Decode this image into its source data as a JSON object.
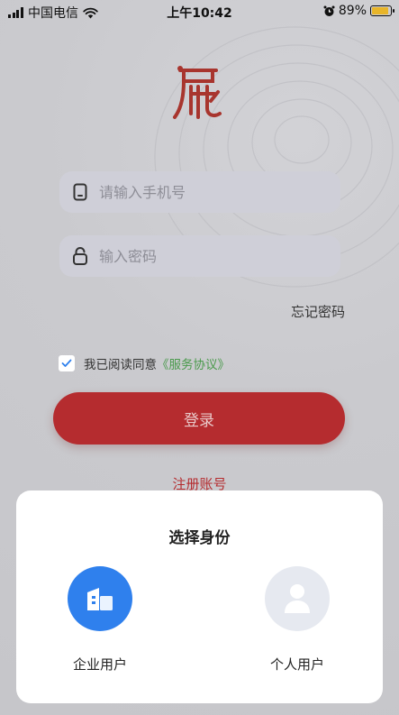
{
  "status_bar": {
    "carrier": "中国电信",
    "time": "上午10:42",
    "battery_percent": "89%",
    "battery_level": 0.89
  },
  "logo": {
    "alt": "展"
  },
  "login_form": {
    "phone_placeholder": "请输入手机号",
    "password_placeholder": "输入密码",
    "forgot_password": "忘记密码",
    "agreement_prefix": "我已阅读同意",
    "agreement_link": "《服务协议》",
    "agreement_checked": true,
    "login_button": "登录",
    "register_link": "注册账号"
  },
  "identity_sheet": {
    "title": "选择身份",
    "roles": [
      {
        "label": "企业用户",
        "icon": "building-icon",
        "color": "#2f80ed"
      },
      {
        "label": "个人用户",
        "icon": "person-icon",
        "color": "#e6e9f0"
      }
    ]
  },
  "colors": {
    "accent_red": "#b52c2f",
    "link_green": "#4a9a4c",
    "enterprise_blue": "#2f80ed"
  }
}
